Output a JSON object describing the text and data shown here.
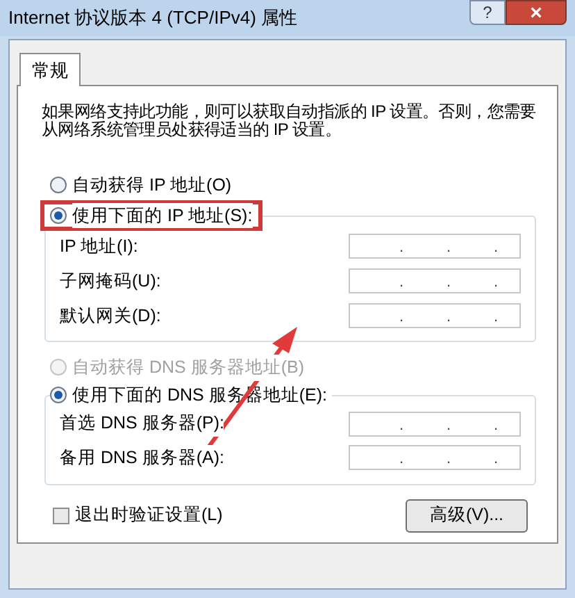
{
  "window": {
    "title": "Internet 协议版本 4 (TCP/IPv4) 属性",
    "help": "?",
    "close": "×"
  },
  "tabs": [
    {
      "label": "常规",
      "selected": true
    }
  ],
  "description": "如果网络支持此功能，则可以获取自动指派的 IP 设置。否则，您需要从网络系统管理员处获得适当的 IP 设置。",
  "ip_mode": [
    {
      "label": "自动获得 IP 地址(O)",
      "selected": false,
      "disabled": false,
      "highlighted": false
    },
    {
      "label": "使用下面的 IP 地址(S):",
      "selected": true,
      "disabled": false,
      "highlighted": true
    }
  ],
  "ip_fields": [
    {
      "label": "IP 地址(I):",
      "dots": [
        ".",
        ".",
        "."
      ]
    },
    {
      "label": "子网掩码(U):",
      "dots": [
        ".",
        ".",
        "."
      ]
    },
    {
      "label": "默认网关(D):",
      "dots": [
        ".",
        ".",
        "."
      ]
    }
  ],
  "dns_mode": [
    {
      "label": "自动获得 DNS 服务器地址(B)",
      "selected": false,
      "disabled": true,
      "highlighted": false
    },
    {
      "label": "使用下面的 DNS 服务器地址(E):",
      "selected": true,
      "disabled": false,
      "highlighted": false
    }
  ],
  "dns_fields": [
    {
      "label": "首选 DNS 服务器(P):",
      "dots": [
        ".",
        ".",
        "."
      ]
    },
    {
      "label": "备用 DNS 服务器(A):",
      "dots": [
        ".",
        ".",
        "."
      ]
    }
  ],
  "validate": {
    "label": "退出时验证设置(L)",
    "checked": false
  },
  "advanced_button": "高级(V)..."
}
